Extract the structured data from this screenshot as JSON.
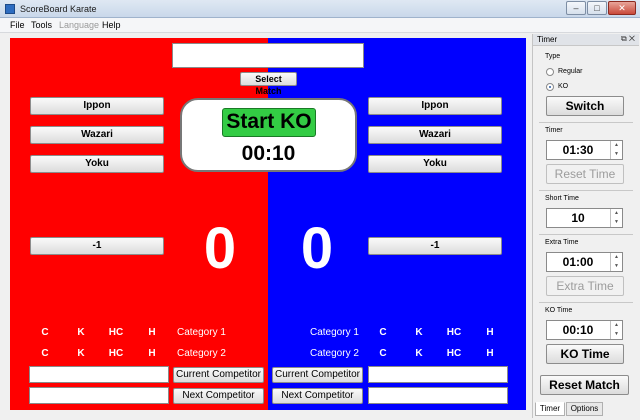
{
  "window": {
    "title": "ScoreBoard Karate",
    "controls": [
      "–",
      "□",
      "✕"
    ]
  },
  "menu": {
    "items": [
      {
        "label": "File",
        "disabled": false
      },
      {
        "label": "Tools",
        "disabled": false
      },
      {
        "label": "Language",
        "disabled": true
      },
      {
        "label": "Help",
        "disabled": false
      }
    ]
  },
  "arena": {
    "match_name": "",
    "select_match_label": "Select Match",
    "start_label": "Start KO",
    "clock": "00:10",
    "left": {
      "color": "#ff0000",
      "ippon": "Ippon",
      "wazari": "Wazari",
      "yoku": "Yoku",
      "minus": "-1",
      "score": "0",
      "penalties": [
        "C",
        "K",
        "HC",
        "H"
      ],
      "category1": "Category 1",
      "category2": "Category 2",
      "current_value": "",
      "next_value": "",
      "current_label": "Current Competitor",
      "next_label": "Next Competitor"
    },
    "right": {
      "color": "#0000ff",
      "ippon": "Ippon",
      "wazari": "Wazari",
      "yoku": "Yoku",
      "minus": "-1",
      "score": "0",
      "penalties": [
        "C",
        "K",
        "HC",
        "H"
      ],
      "category1": "Category 1",
      "category2": "Category 2",
      "current_value": "",
      "next_value": "",
      "current_label": "Current Competitor",
      "next_label": "Next Competitor"
    }
  },
  "panel": {
    "title": "Timer",
    "icons": [
      "⧉",
      "✕"
    ],
    "type_label": "Type",
    "regular_label": "Regular",
    "ko_label": "KO",
    "selected_type": "KO",
    "switch_label": "Switch",
    "timer_label": "Timer",
    "timer_value": "01:30",
    "reset_time_label": "Reset Time",
    "short_time_label": "Short Time",
    "short_time_value": "10",
    "extra_time_label": "Extra Time",
    "extra_time_value": "01:00",
    "extra_time_button": "Extra Time",
    "ko_time_label": "KO Time",
    "ko_time_value": "00:10",
    "ko_time_button": "KO Time",
    "reset_match_label": "Reset Match",
    "tabs": [
      {
        "label": "Timer",
        "active": true
      },
      {
        "label": "Options",
        "active": false
      }
    ]
  }
}
